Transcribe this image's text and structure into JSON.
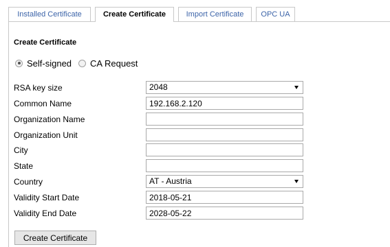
{
  "tabs": [
    {
      "label": "Installed Certificate",
      "active": false
    },
    {
      "label": "Create Certificate",
      "active": true
    },
    {
      "label": "Import Certificate",
      "active": false
    },
    {
      "label": "OPC UA",
      "active": false
    }
  ],
  "section": {
    "title": "Create Certificate"
  },
  "mode": {
    "options": [
      {
        "label": "Self-signed",
        "checked": true
      },
      {
        "label": "CA Request",
        "checked": false
      }
    ]
  },
  "form": {
    "rsa_key_size": {
      "label": "RSA key size",
      "value": "2048"
    },
    "common_name": {
      "label": "Common Name",
      "value": "192.168.2.120"
    },
    "organization_name": {
      "label": "Organization Name",
      "value": ""
    },
    "organization_unit": {
      "label": "Organization Unit",
      "value": ""
    },
    "city": {
      "label": "City",
      "value": ""
    },
    "state": {
      "label": "State",
      "value": ""
    },
    "country": {
      "label": "Country",
      "value": "AT - Austria"
    },
    "validity_start_date": {
      "label": "Validity Start Date",
      "value": "2018-05-21"
    },
    "validity_end_date": {
      "label": "Validity End Date",
      "value": "2028-05-22"
    }
  },
  "actions": {
    "create_label": "Create Certificate"
  },
  "icons": {
    "select_arrow": "chevron-down-icon"
  }
}
